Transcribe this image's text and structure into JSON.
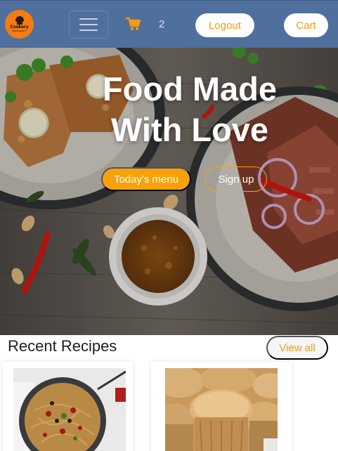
{
  "navbar": {
    "logo": {
      "text": "Cookery",
      "sub": "RESTAURANT",
      "color": "#f47c12",
      "icon": "chef-hat-icon"
    },
    "menu_toggle_icon": "hamburger-icon",
    "cart_icon": "shopping-cart-icon",
    "cart_count": "2",
    "logout_label": "Logout",
    "cart_label": "Cart",
    "background": "#4f6f9d",
    "accent": "#f39c12"
  },
  "hero": {
    "title_line1": "Food Made",
    "title_line2": "With Love",
    "menu_button": "Today's menu",
    "signup_button": "Sign up"
  },
  "recent": {
    "title": "Recent Recipes",
    "view_all": "View all",
    "cards": [
      {
        "image": "spaghetti-pan-image"
      },
      {
        "image": "muffins-image"
      }
    ]
  }
}
